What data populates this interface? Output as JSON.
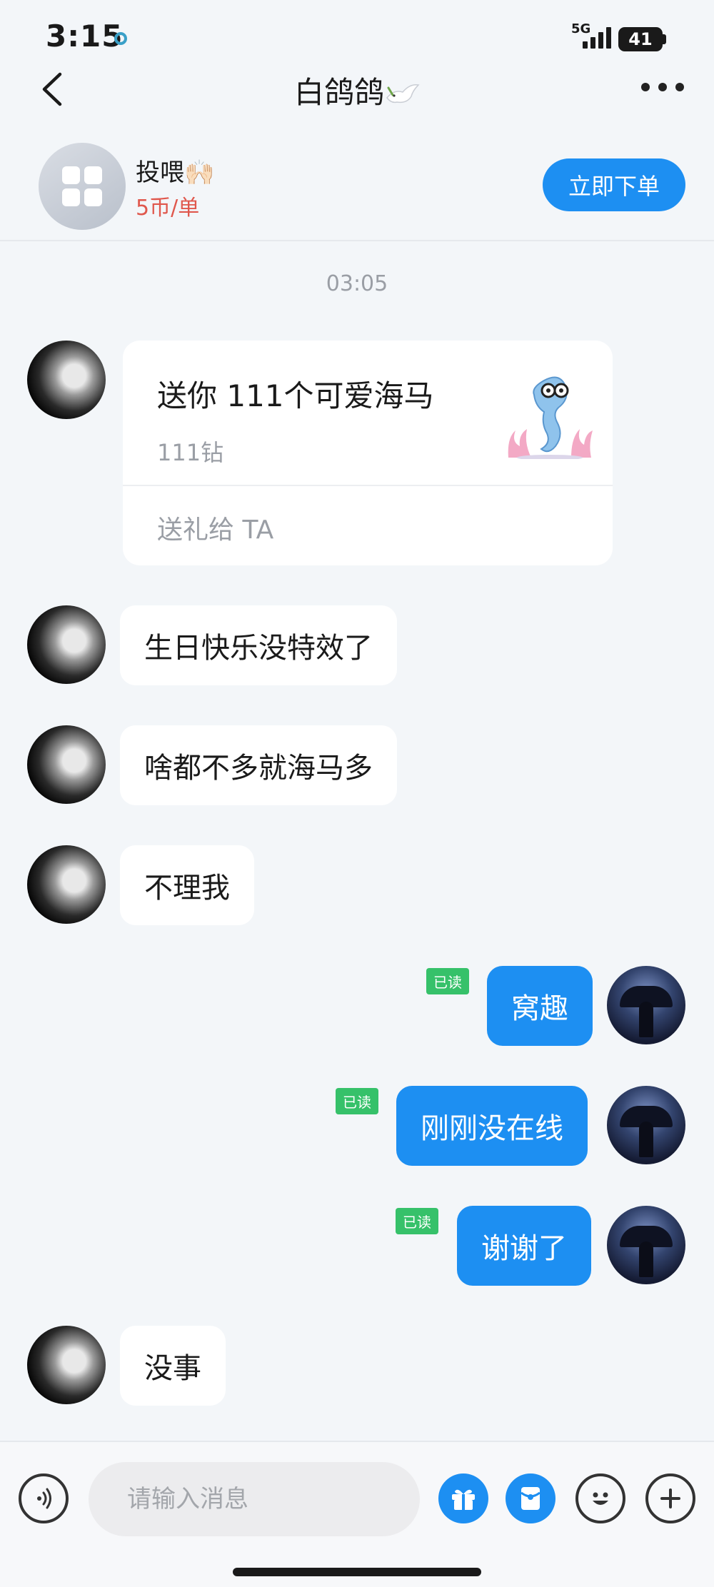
{
  "status_bar": {
    "time": "3:15",
    "network": "5G",
    "battery": "41"
  },
  "header": {
    "title": "白鸽鸽"
  },
  "service": {
    "name": "投喂🙌🏻",
    "price": "5币/单",
    "order_button": "立即下单"
  },
  "chat": {
    "timestamp": "03:05",
    "gift": {
      "title": "送你 111个可爱海马",
      "amount": "111钻",
      "action": "送礼给 TA"
    },
    "messages": [
      {
        "from": "them",
        "text": "生日快乐没特效了"
      },
      {
        "from": "them",
        "text": "啥都不多就海马多"
      },
      {
        "from": "them",
        "text": "不理我"
      },
      {
        "from": "me",
        "text": "窝趣",
        "status": "已读"
      },
      {
        "from": "me",
        "text": "刚刚没在线",
        "status": "已读"
      },
      {
        "from": "me",
        "text": "谢谢了",
        "status": "已读"
      },
      {
        "from": "them",
        "text": "没事"
      }
    ]
  },
  "input": {
    "placeholder": "请输入消息"
  },
  "colors": {
    "accent": "#1d8ff2",
    "read_badge": "#36c16a",
    "price": "#e0584d"
  }
}
